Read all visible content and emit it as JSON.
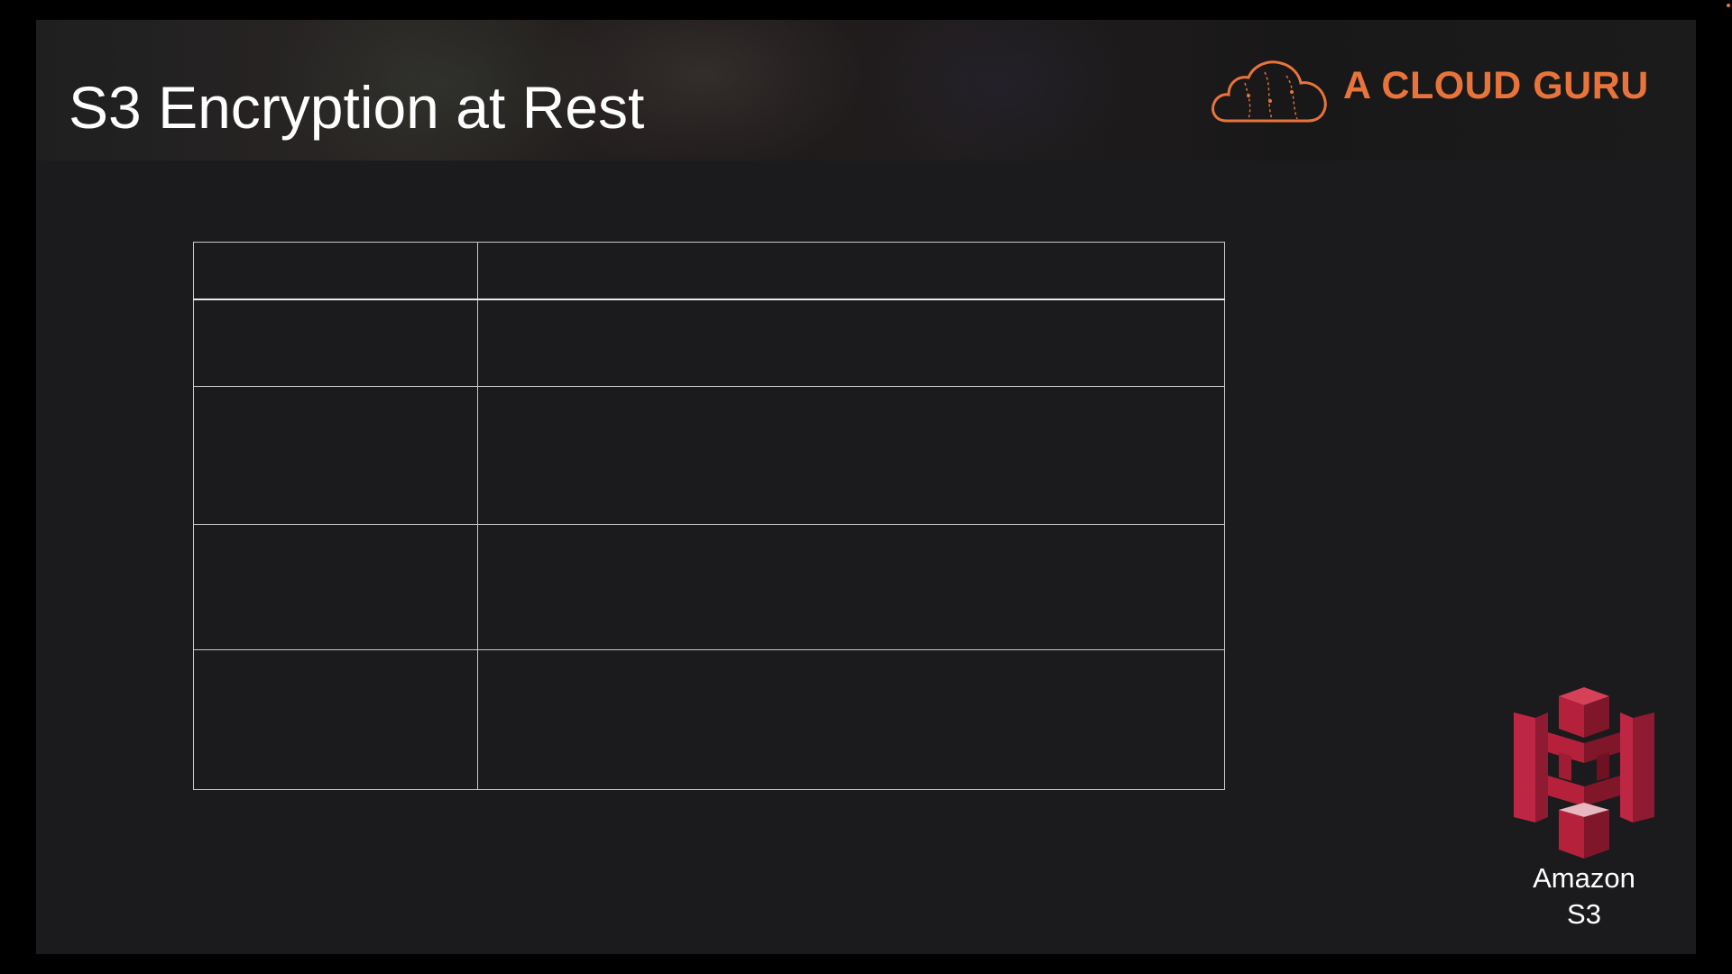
{
  "slide": {
    "title": "S3 Encryption at Rest"
  },
  "brand": {
    "name": "A CLOUD GURU",
    "logo_icon": "cloud-logo-icon",
    "accent_color": "#e9743b"
  },
  "table": {
    "header": [
      "",
      ""
    ],
    "rows": [
      [
        "",
        ""
      ],
      [
        "",
        ""
      ],
      [
        "",
        ""
      ],
      [
        "",
        ""
      ]
    ]
  },
  "service": {
    "icon": "amazon-s3-icon",
    "label_line1": "Amazon",
    "label_line2": "S3",
    "icon_color": "#b5213a"
  }
}
